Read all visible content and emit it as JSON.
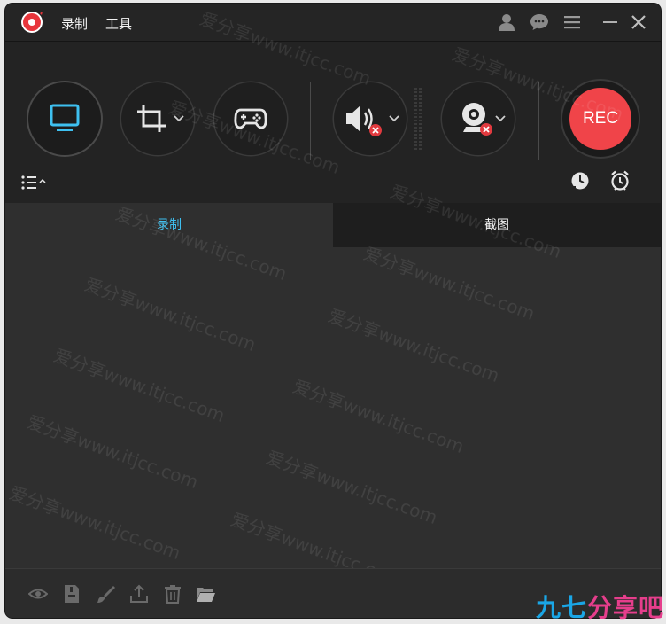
{
  "titlebar": {
    "menu": [
      "录制",
      "工具"
    ]
  },
  "toolbar": {
    "rec_label": "REC"
  },
  "tabs": [
    "录制",
    "截图"
  ],
  "watermark": "爱分享www.itjcc.com",
  "brand": {
    "part1": "九七",
    "part2": "分享吧"
  },
  "icons": {
    "logo": "record-logo-icon",
    "user": "user-icon",
    "feedback": "chat-bubble-icon",
    "menu": "hamburger-menu-icon",
    "minimize": "minimize-icon",
    "close": "close-icon",
    "screen": "monitor-icon",
    "region": "crop-icon",
    "game": "gamepad-icon",
    "system_audio": "speaker-icon",
    "webcam": "webcam-icon",
    "list": "list-icon",
    "schedule": "clock-icon",
    "alarm": "alarm-clock-icon",
    "preview": "eye-icon",
    "save": "save-file-icon",
    "edit": "brush-icon",
    "share": "upload-icon",
    "delete": "trash-icon",
    "folder": "folder-icon"
  },
  "colors": {
    "accent_blue": "#3ec0f0",
    "rec_red": "#f04449",
    "background": "#2f2f2f"
  }
}
